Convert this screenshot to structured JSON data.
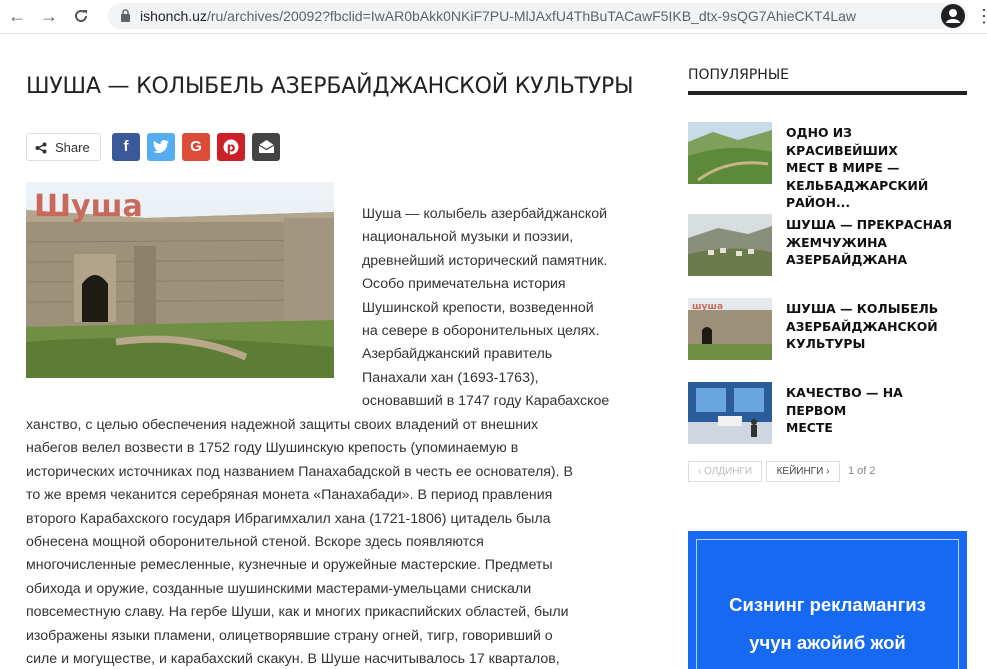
{
  "browser": {
    "url_domain": "ishonch.uz",
    "url_path": "/ru/archives/20092?fbclid=IwAR0bAkk0NKiF7PU-MlJAxfU4ThBuTACawF5IKB_dtx-9sQG7AhieCKT4Law"
  },
  "article": {
    "title": "ШУША — КОЛЫБЕЛЬ АЗЕРБАЙДЖАНСКОЙ КУЛЬТУРЫ",
    "share_label": "Share",
    "image_sign": "Шуша",
    "wrap_lines": [
      "Шуша — колыбель азербайджанской",
      "национальной музыки и поэзии,",
      "древнейший исторический памятник.",
      "Особо примечательна история",
      "Шушинской крепости, возведенной",
      "на севере в оборонительных целях.",
      "Азербайджанский правитель",
      "Панахали хан (1693-1763),",
      "основавший в 1747 году Карабахское"
    ],
    "full_lines": [
      "ханство, с целью обеспечения надежной защиты своих владений от внешних",
      "набегов велел возвести в 1752 году Шушинскую крепость (упоминаемую в",
      "исторических источниках под названием Панахабадской в честь ее основателя). В",
      "то же время чеканится серебряная монета «Панахабади». В период правления",
      "второго Карабахского государя Ибрагимхалил хана (1721-1806) цитадель была",
      "обнесена мощной оборонительной стеной. Вскоре здесь появляются",
      "многочисленные ремесленные, кузнечные и оружейные мастерские. Предметы",
      "обихода и оружие, созданные шушинскими мастерами-умельцами снискали",
      "повсеместную славу. На гербе Шуши, как и многих прикаспийских областей, были",
      "изображены языки пламени, олицетворявшие страну огней, тигр, говоривший о",
      "силе и могуществе, и карабахский скакун. В Шуше насчитывалось 17 кварталов,"
    ]
  },
  "sidebar": {
    "popular_title": "ПОПУЛЯРНЫЕ",
    "items": [
      {
        "l1": "ОДНО ИЗ КРАСИВЕЙШИХ",
        "l2": "МЕСТ В МИРЕ —",
        "l3": "КЕЛЬБАДЖАРСКИЙ",
        "l4": "РАЙОН..."
      },
      {
        "l1": "ШУША — ПРЕКРАСНАЯ",
        "l2": "ЖЕМЧУЖИНА",
        "l3": "АЗЕРБАЙДЖАНА"
      },
      {
        "l1": "ШУША — КОЛЫБЕЛЬ",
        "l2": "АЗЕРБАЙДЖАНСКОЙ",
        "l3": "КУЛЬТУРЫ"
      },
      {
        "l1": "КАЧЕСТВО — НА ПЕРВОМ",
        "l2": "МЕСТЕ"
      }
    ],
    "pager": {
      "prev": "‹ ОЛДИНГИ",
      "next": "КЕЙИНГИ ›",
      "info": "1 of 2"
    },
    "ad": {
      "line1": "Сизнинг рекламангиз",
      "line2": "учун ажойиб жой"
    }
  }
}
